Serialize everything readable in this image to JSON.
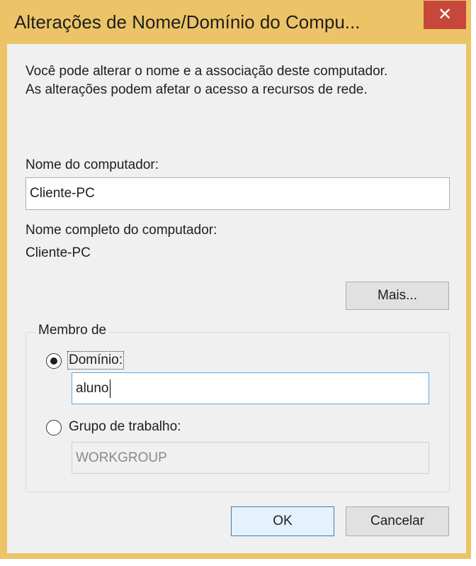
{
  "window": {
    "title": "Alterações de Nome/Domínio do Compu...",
    "close_glyph": "✕"
  },
  "intro": {
    "line1": "Você pode alterar o nome e a associação deste computador.",
    "line2": "As alterações podem afetar o acesso a recursos de rede."
  },
  "computer_name": {
    "label": "Nome do computador:",
    "value": "Cliente-PC"
  },
  "full_name": {
    "label": "Nome completo do computador:",
    "value": "Cliente-PC"
  },
  "more_button": "Mais...",
  "member_of": {
    "legend": "Membro de",
    "domain_label": "Domínio:",
    "domain_value": "aluno",
    "domain_selected": true,
    "workgroup_label": "Grupo de trabalho:",
    "workgroup_value": "WORKGROUP",
    "workgroup_selected": false
  },
  "buttons": {
    "ok": "OK",
    "cancel": "Cancelar"
  },
  "colors": {
    "title_bar": "#ecc467",
    "close_button": "#c7483a",
    "focus_border": "#5ca8e6"
  }
}
